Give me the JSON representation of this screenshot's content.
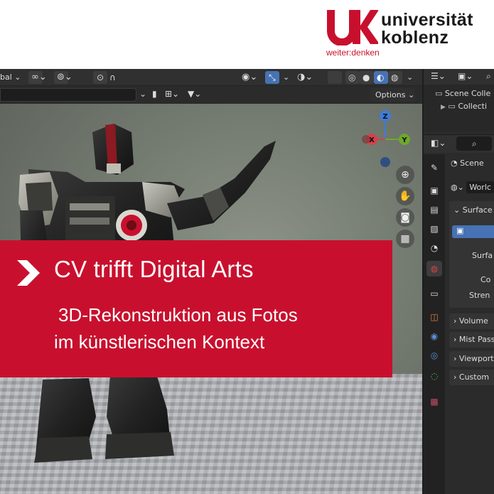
{
  "brand": {
    "logo_mark": "uk",
    "name_line1": "universität",
    "name_line2": "koblenz",
    "tagline": "weiter:denken",
    "accent_color": "#c8102e"
  },
  "banner": {
    "title": "CV trifft Digital Arts",
    "subtitle_line1": "3D-Rekonstruktion aus Fotos",
    "subtitle_line2": "im künstlerischen Kontext",
    "icon": "chevron-right-icon"
  },
  "viewport": {
    "header_left_text": "bal",
    "options_label": "Options",
    "gizmo": {
      "z": "Z",
      "x": "X",
      "y": "Y"
    },
    "nav_buttons": [
      "zoom-icon",
      "hand-icon",
      "camera-icon",
      "grid-icon"
    ]
  },
  "outliner": {
    "scene_collection": "Scene Colle",
    "collection": "Collecti"
  },
  "properties": {
    "scene_label": "Scene",
    "world_label": "Worlc",
    "surface_panel": "Surface",
    "surface_field": "Surfa",
    "color_field": "Co",
    "strength_field": "Stren",
    "volume_panel": "Volume",
    "mist_panel": "Mist Pass",
    "viewport_panel": "Viewport",
    "custom_panel": "Custom"
  }
}
